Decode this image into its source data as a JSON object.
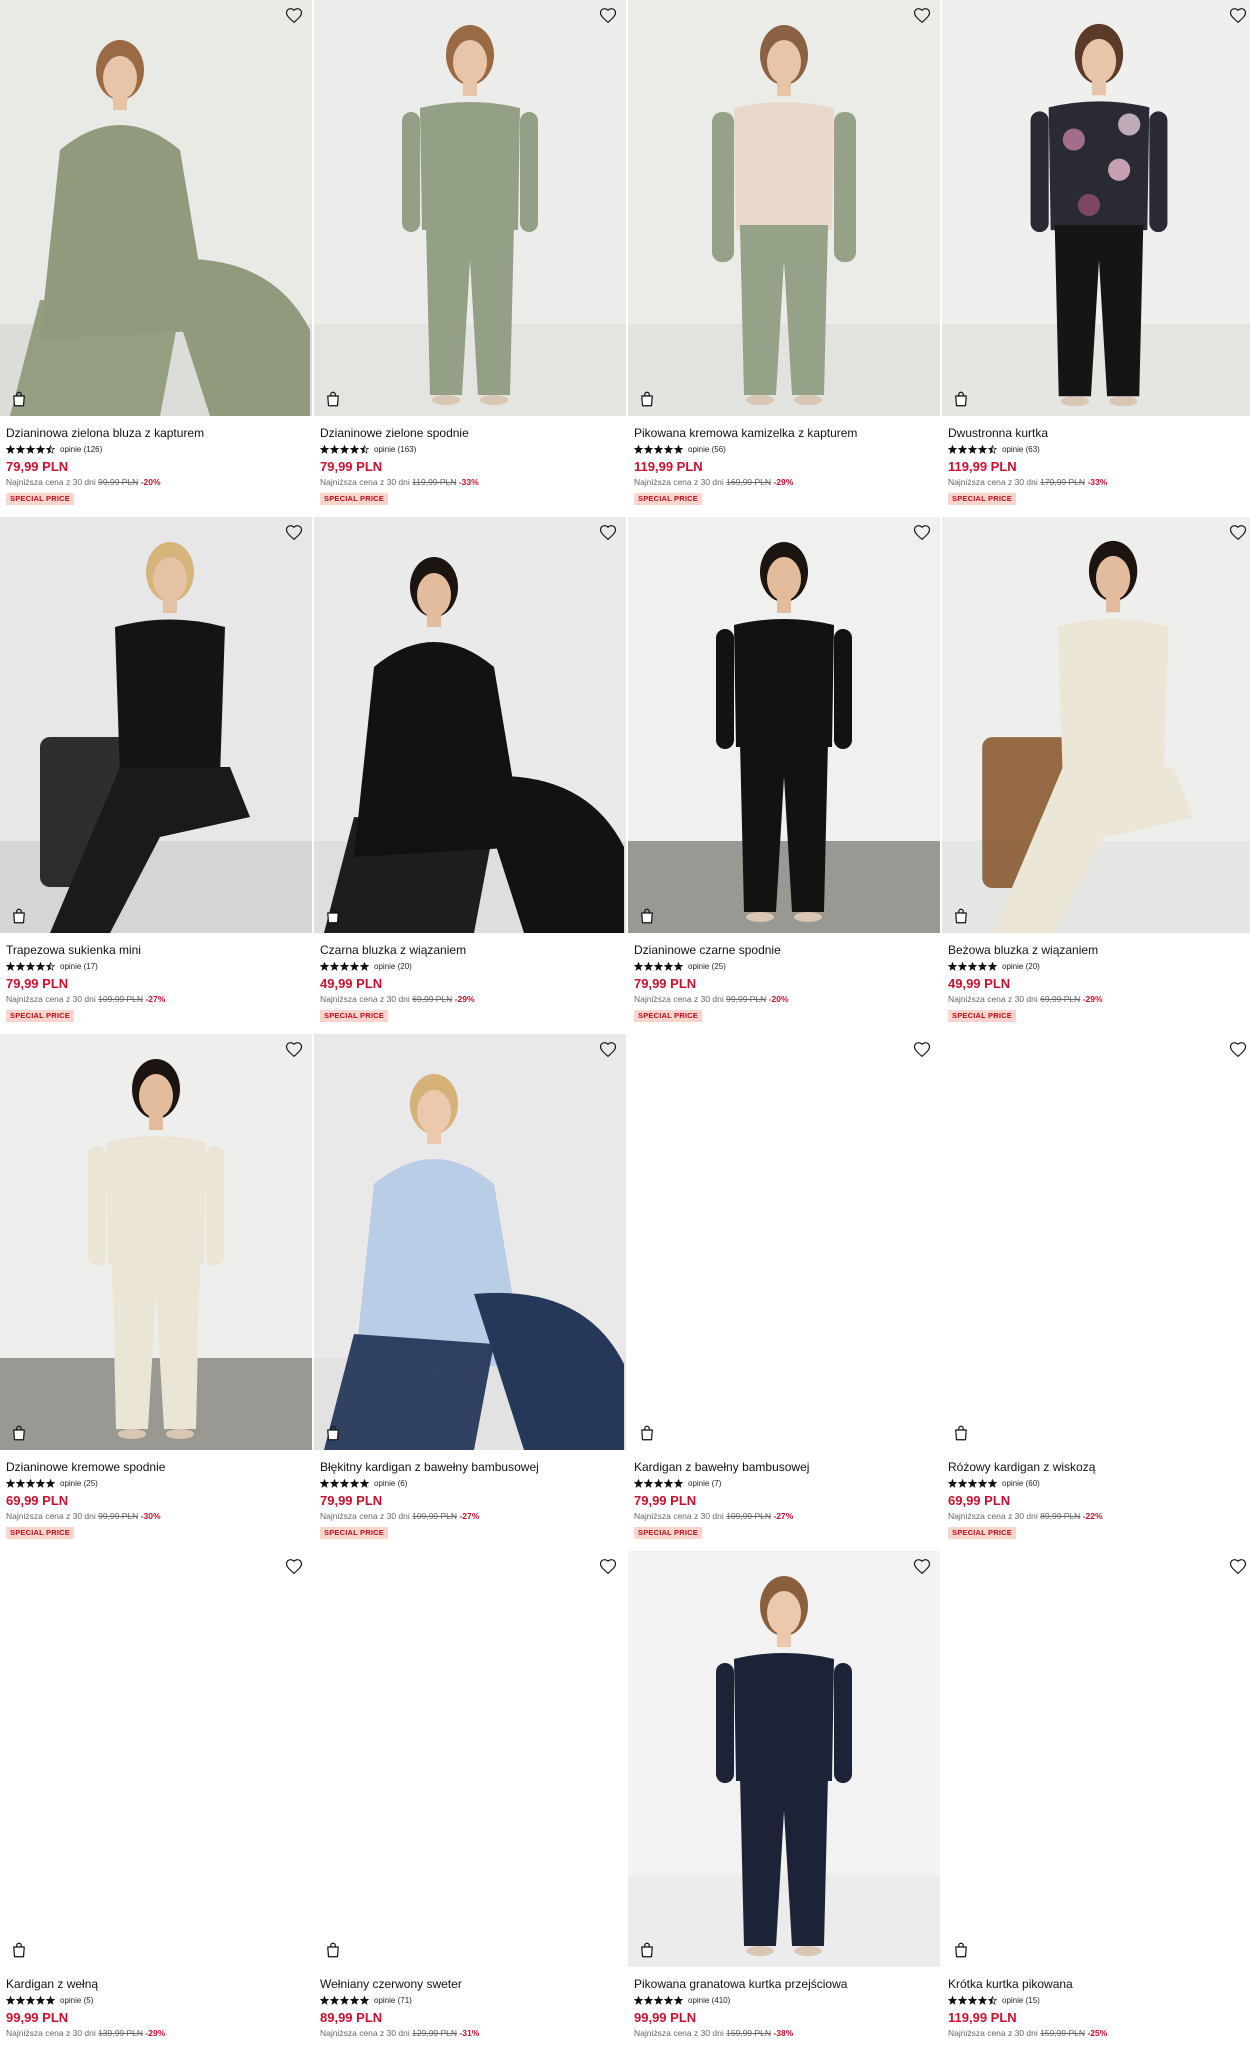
{
  "colors": {
    "price": "#c8102e",
    "badge_bg": "#fbd5cc",
    "badge_text": "#b4101f"
  },
  "icons": {
    "wishlist": "heart-icon",
    "add_to_bag": "shopping-bag-icon",
    "rating": "star-icon"
  },
  "products": [
    {
      "name": "Dzianinowa zielona bluza z kapturem",
      "rating": 4.5,
      "reviews": "opinie (126)",
      "price": "79,99 PLN",
      "lowest_label": "Najniższa cena z 30 dni",
      "old_price": "99,99 PLN",
      "discount": "-20%",
      "badge": "SPECIAL PRICE",
      "photo": true
    },
    {
      "name": "Dzianinowe zielone spodnie",
      "rating": 4.5,
      "reviews": "opinie (163)",
      "price": "79,99 PLN",
      "lowest_label": "Najniższa cena z 30 dni",
      "old_price": "119,99 PLN",
      "discount": "-33%",
      "badge": "SPECIAL PRICE",
      "photo": true
    },
    {
      "name": "Pikowana kremowa kamizelka z kapturem",
      "rating": 5,
      "reviews": "opinie (56)",
      "price": "119,99 PLN",
      "lowest_label": "Najniższa cena z 30 dni",
      "old_price": "169,99 PLN",
      "discount": "-29%",
      "badge": "SPECIAL PRICE",
      "photo": true
    },
    {
      "name": "Dwustronna kurtka",
      "rating": 4.5,
      "reviews": "opinie (63)",
      "price": "119,99 PLN",
      "lowest_label": "Najniższa cena z 30 dni",
      "old_price": "179,99 PLN",
      "discount": "-33%",
      "badge": "SPECIAL PRICE",
      "photo": true
    },
    {
      "name": "Trapezowa sukienka mini",
      "rating": 4.5,
      "reviews": "opinie (17)",
      "price": "79,99 PLN",
      "lowest_label": "Najniższa cena z 30 dni",
      "old_price": "109,99 PLN",
      "discount": "-27%",
      "badge": "SPECIAL PRICE",
      "photo": true
    },
    {
      "name": "Czarna bluzka z wiązaniem",
      "rating": 5,
      "reviews": "opinie (20)",
      "price": "49,99 PLN",
      "lowest_label": "Najniższa cena z 30 dni",
      "old_price": "69,99 PLN",
      "discount": "-29%",
      "badge": "SPECIAL PRICE",
      "photo": true
    },
    {
      "name": "Dzianinowe czarne spodnie",
      "rating": 5,
      "reviews": "opinie (25)",
      "price": "79,99 PLN",
      "lowest_label": "Najniższa cena z 30 dni",
      "old_price": "99,99 PLN",
      "discount": "-20%",
      "badge": "SPECIAL PRICE",
      "photo": true
    },
    {
      "name": "Beżowa bluzka z wiązaniem",
      "rating": 5,
      "reviews": "opinie (20)",
      "price": "49,99 PLN",
      "lowest_label": "Najniższa cena z 30 dni",
      "old_price": "69,99 PLN",
      "discount": "-29%",
      "badge": "SPECIAL PRICE",
      "photo": true
    },
    {
      "name": "Dzianinowe kremowe spodnie",
      "rating": 5,
      "reviews": "opinie (25)",
      "price": "69,99 PLN",
      "lowest_label": "Najniższa cena z 30 dni",
      "old_price": "99,99 PLN",
      "discount": "-30%",
      "badge": "SPECIAL PRICE",
      "photo": true
    },
    {
      "name": "Błękitny kardigan z bawełny bambusowej",
      "rating": 5,
      "reviews": "opinie (6)",
      "price": "79,99 PLN",
      "lowest_label": "Najniższa cena z 30 dni",
      "old_price": "109,99 PLN",
      "discount": "-27%",
      "badge": "SPECIAL PRICE",
      "photo": true
    },
    {
      "name": "Kardigan z bawełny bambusowej",
      "rating": 5,
      "reviews": "opinie (7)",
      "price": "79,99 PLN",
      "lowest_label": "Najniższa cena z 30 dni",
      "old_price": "109,99 PLN",
      "discount": "-27%",
      "badge": "SPECIAL PRICE",
      "photo": false
    },
    {
      "name": "Różowy kardigan z wiskozą",
      "rating": 5,
      "reviews": "opinie (60)",
      "price": "69,99 PLN",
      "lowest_label": "Najniższa cena z 30 dni",
      "old_price": "89,99 PLN",
      "discount": "-22%",
      "badge": "SPECIAL PRICE",
      "photo": false
    },
    {
      "name": "Kardigan z wełną",
      "rating": 5,
      "reviews": "opinie (5)",
      "price": "99,99 PLN",
      "lowest_label": "Najniższa cena z 30 dni",
      "old_price": "139,99 PLN",
      "discount": "-29%",
      "badge": "",
      "photo": false
    },
    {
      "name": "Wełniany czerwony sweter",
      "rating": 5,
      "reviews": "opinie (71)",
      "price": "89,99 PLN",
      "lowest_label": "Najniższa cena z 30 dni",
      "old_price": "129,99 PLN",
      "discount": "-31%",
      "badge": "",
      "photo": false
    },
    {
      "name": "Pikowana granatowa kurtka przejściowa",
      "rating": 5,
      "reviews": "opinie (410)",
      "price": "99,99 PLN",
      "lowest_label": "Najniższa cena z 30 dni",
      "old_price": "159,99 PLN",
      "discount": "-38%",
      "badge": "",
      "photo": true
    },
    {
      "name": "Krótka kurtka pikowana",
      "rating": 4.5,
      "reviews": "opinie (15)",
      "price": "119,99 PLN",
      "lowest_label": "Najniższa cena z 30 dni",
      "old_price": "159,99 PLN",
      "discount": "-25%",
      "badge": "",
      "photo": false
    }
  ]
}
